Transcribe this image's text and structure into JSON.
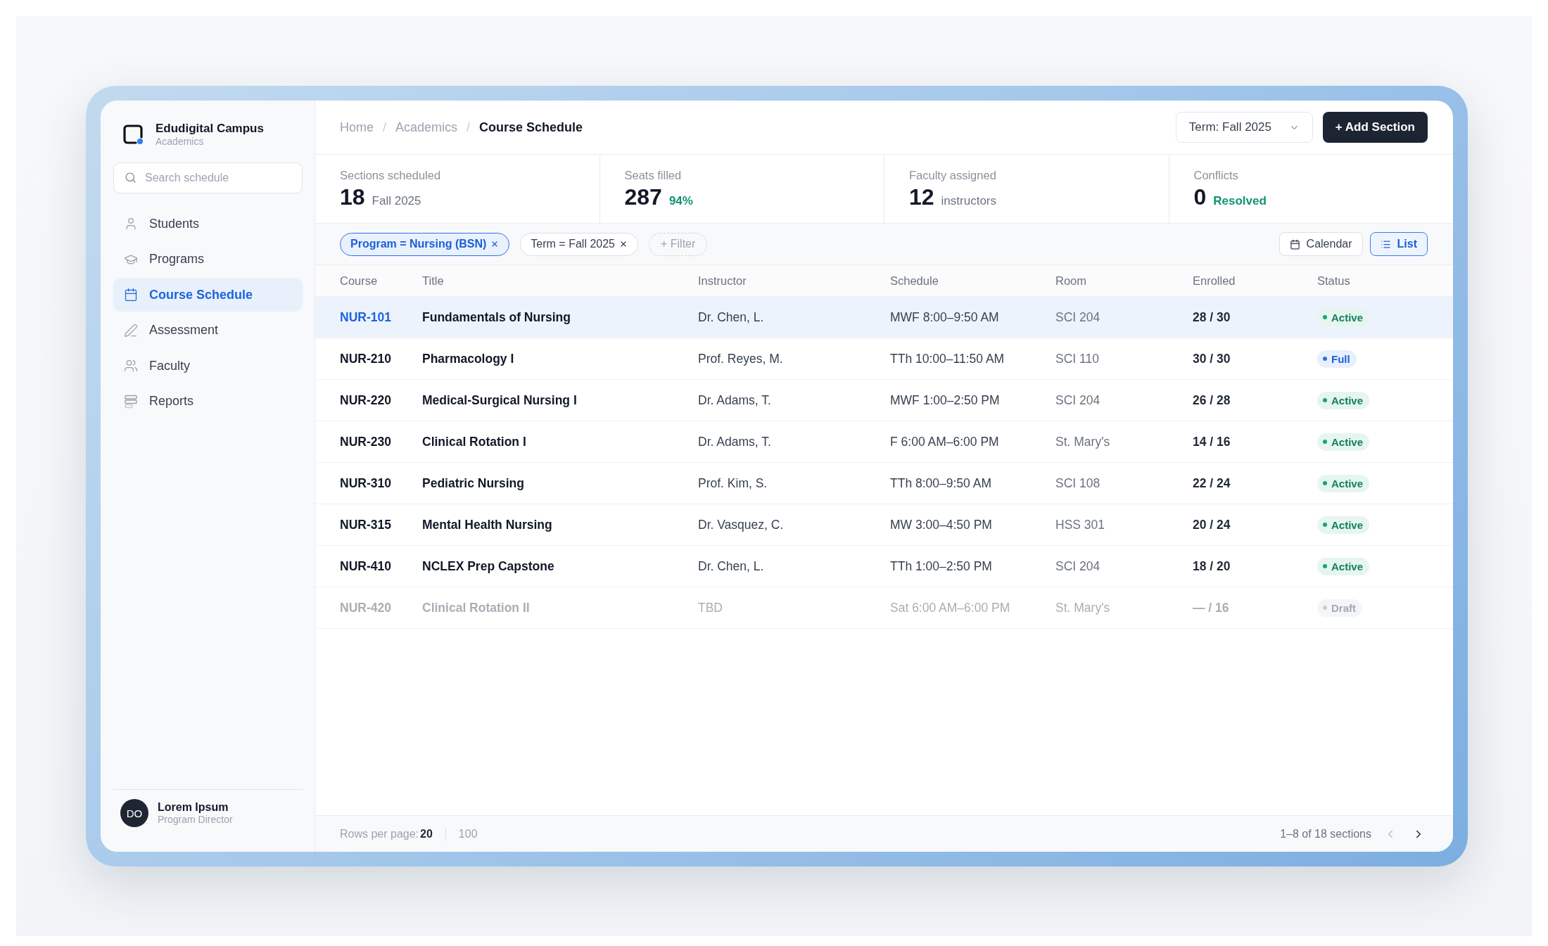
{
  "sidebar": {
    "brand": {
      "name": "Edudigital Campus",
      "subtitle": "Academics"
    },
    "search": {
      "placeholder": "Search schedule"
    },
    "nav": [
      {
        "label": "Students",
        "selected": false
      },
      {
        "label": "Programs",
        "selected": false
      },
      {
        "label": "Course Schedule",
        "selected": true
      },
      {
        "label": "Assessment",
        "selected": false
      },
      {
        "label": "Faculty",
        "selected": false
      },
      {
        "label": "Reports",
        "selected": false
      }
    ],
    "user": {
      "initials": "DO",
      "name": "Lorem Ipsum",
      "role": "Program Director"
    }
  },
  "header": {
    "breadcrumb": [
      {
        "label": "Home",
        "current": false,
        "separator": "/"
      },
      {
        "label": "Academics",
        "current": false,
        "separator": "/"
      },
      {
        "label": "Course Schedule",
        "current": true
      }
    ],
    "term_select": "Term: Fall 2025",
    "add_button": "+ Add Section"
  },
  "stats": [
    {
      "label": "Sections scheduled",
      "value": "18",
      "note": "Fall 2025",
      "positive": false
    },
    {
      "label": "Seats filled",
      "value": "287",
      "note": "94%",
      "positive": true
    },
    {
      "label": "Faculty assigned",
      "value": "12",
      "note": "instructors",
      "positive": false
    },
    {
      "label": "Conflicts",
      "value": "0",
      "note": "Resolved",
      "positive": true
    }
  ],
  "filters": {
    "chips": [
      {
        "label": "Program = Nursing (BSN)",
        "selected": true
      },
      {
        "label": "Term = Fall 2025",
        "selected": false
      }
    ],
    "add_filter": "+ Filter",
    "views": [
      {
        "label": "Calendar",
        "selected": false
      },
      {
        "label": "List",
        "selected": true
      }
    ]
  },
  "table": {
    "columns": [
      "Course",
      "Title",
      "Instructor",
      "Schedule",
      "Room",
      "Enrolled",
      "Status"
    ],
    "rows": [
      {
        "course": "NUR-101",
        "title": "Fundamentals of Nursing",
        "instructor": "Dr. Chen, L.",
        "schedule": "MWF 8:00–9:50 AM",
        "room": "SCI 204",
        "enrolled": "28 / 30",
        "status": {
          "label": "Active",
          "kind": "active"
        },
        "selected": true,
        "disabled": false
      },
      {
        "course": "NUR-210",
        "title": "Pharmacology I",
        "instructor": "Prof. Reyes, M.",
        "schedule": "TTh 10:00–11:50 AM",
        "room": "SCI 110",
        "enrolled": "30 / 30",
        "status": {
          "label": "Full",
          "kind": "full"
        },
        "selected": false,
        "disabled": false
      },
      {
        "course": "NUR-220",
        "title": "Medical-Surgical Nursing I",
        "instructor": "Dr. Adams, T.",
        "schedule": "MWF 1:00–2:50 PM",
        "room": "SCI 204",
        "enrolled": "26 / 28",
        "status": {
          "label": "Active",
          "kind": "active"
        },
        "selected": false,
        "disabled": false
      },
      {
        "course": "NUR-230",
        "title": "Clinical Rotation I",
        "instructor": "Dr. Adams, T.",
        "schedule": "F 6:00 AM–6:00 PM",
        "room": "St. Mary's",
        "enrolled": "14 / 16",
        "status": {
          "label": "Active",
          "kind": "active"
        },
        "selected": false,
        "disabled": false
      },
      {
        "course": "NUR-310",
        "title": "Pediatric Nursing",
        "instructor": "Prof. Kim, S.",
        "schedule": "TTh 8:00–9:50 AM",
        "room": "SCI 108",
        "enrolled": "22 / 24",
        "status": {
          "label": "Active",
          "kind": "active"
        },
        "selected": false,
        "disabled": false
      },
      {
        "course": "NUR-315",
        "title": "Mental Health Nursing",
        "instructor": "Dr. Vasquez, C.",
        "schedule": "MW 3:00–4:50 PM",
        "room": "HSS 301",
        "enrolled": "20 / 24",
        "status": {
          "label": "Active",
          "kind": "active"
        },
        "selected": false,
        "disabled": false
      },
      {
        "course": "NUR-410",
        "title": "NCLEX Prep Capstone",
        "instructor": "Dr. Chen, L.",
        "schedule": "TTh 1:00–2:50 PM",
        "room": "SCI 204",
        "enrolled": "18 / 20",
        "status": {
          "label": "Active",
          "kind": "active"
        },
        "selected": false,
        "disabled": false
      },
      {
        "course": "NUR-420",
        "title": "Clinical Rotation II",
        "instructor": "TBD",
        "schedule": "Sat 6:00 AM–6:00 PM",
        "room": "St. Mary's",
        "enrolled": "— / 16",
        "status": {
          "label": "Draft",
          "kind": "draft"
        },
        "selected": false,
        "disabled": true
      }
    ]
  },
  "footer": {
    "rows_per_page_label": "Rows per page:",
    "page_sizes": [
      {
        "label": "20",
        "selected": true
      },
      {
        "label": "100",
        "selected": false
      }
    ],
    "range": "1–8 of 18 sections",
    "prev_disabled": true,
    "next_disabled": false
  }
}
